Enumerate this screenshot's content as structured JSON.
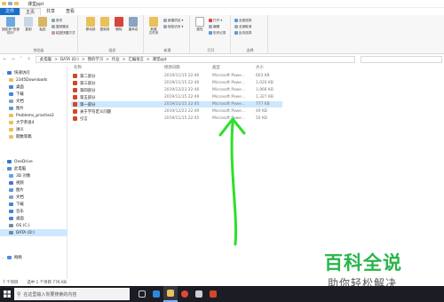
{
  "window": {
    "title": "课堂ppt"
  },
  "ribbon": {
    "tabs": [
      "文件",
      "主页",
      "共享",
      "查看"
    ],
    "active_tab": "主页",
    "groups": {
      "clipboard": {
        "title": "剪贴板",
        "pin": "固定到\"快速访问\"",
        "copy": "复制",
        "paste": "粘贴",
        "cut": "剪切",
        "copy_path": "复制路径",
        "paste_shortcut": "粘贴快捷方式"
      },
      "organize": {
        "title": "组织",
        "move_to": "移动到",
        "copy_to": "复制到",
        "delete": "删除",
        "rename": "重命名"
      },
      "new": {
        "title": "新建",
        "new_folder": "新建\n文件夹",
        "new_item": "新建项目 ▾",
        "easy_access": "轻松访问 ▾"
      },
      "open": {
        "title": "打开",
        "properties": "属性",
        "open": "打开 ▾",
        "edit": "编辑",
        "history": "历史记录"
      },
      "select": {
        "title": "选择",
        "select_all": "全部选择",
        "select_none": "全部取消",
        "invert": "反向选择"
      }
    }
  },
  "address": {
    "crumbs": [
      "此电脑",
      "DATA (D:)",
      "我的学习",
      "作业",
      "汇编语言",
      "课堂ppt"
    ],
    "separator": ">"
  },
  "nav": {
    "items": [
      {
        "label": "快速访问",
        "icon": "star-icon",
        "color": "#3a7bd5",
        "indent": 0
      },
      {
        "label": "2345Downloads",
        "icon": "folder-icon",
        "color": "#e8c15a",
        "indent": 1
      },
      {
        "label": "桌面",
        "icon": "desktop-icon",
        "color": "#3f86d6",
        "indent": 1
      },
      {
        "label": "下载",
        "icon": "download-icon",
        "color": "#3f86d6",
        "indent": 1
      },
      {
        "label": "文档",
        "icon": "document-icon",
        "color": "#8aa3c2",
        "indent": 1
      },
      {
        "label": "图片",
        "icon": "picture-icon",
        "color": "#5a9bd8",
        "indent": 1
      },
      {
        "label": "Problems_practise2",
        "icon": "folder-icon",
        "color": "#e8c15a",
        "indent": 1
      },
      {
        "label": "大学英语4",
        "icon": "folder-icon",
        "color": "#e8c15a",
        "indent": 1
      },
      {
        "label": "讲义",
        "icon": "folder-icon",
        "color": "#e8c15a",
        "indent": 1
      },
      {
        "label": "期数等稿",
        "icon": "folder-icon",
        "color": "#e8c15a",
        "indent": 1
      },
      {
        "label": "OneDrive",
        "icon": "cloud-icon",
        "color": "#2f7bd4",
        "indent": 0
      },
      {
        "label": "此电脑",
        "icon": "computer-icon",
        "color": "#4b8fd8",
        "indent": 0
      },
      {
        "label": "3D 对象",
        "icon": "cube-icon",
        "color": "#5aa6e6",
        "indent": 1
      },
      {
        "label": "视频",
        "icon": "video-icon",
        "color": "#5a6bd8",
        "indent": 1
      },
      {
        "label": "图片",
        "icon": "picture-icon",
        "color": "#5a9bd8",
        "indent": 1
      },
      {
        "label": "文档",
        "icon": "document-icon",
        "color": "#8aa3c2",
        "indent": 1
      },
      {
        "label": "下载",
        "icon": "download-icon",
        "color": "#3f86d6",
        "indent": 1
      },
      {
        "label": "音乐",
        "icon": "music-icon",
        "color": "#3f86d6",
        "indent": 1
      },
      {
        "label": "桌面",
        "icon": "desktop-icon",
        "color": "#3f86d6",
        "indent": 1
      },
      {
        "label": "OS (C:)",
        "icon": "drive-icon",
        "color": "#7a8a9a",
        "indent": 1
      },
      {
        "label": "DATA (D:)",
        "icon": "drive-icon",
        "color": "#7a8a9a",
        "indent": 1,
        "selected": true
      },
      {
        "label": "网络",
        "icon": "network-icon",
        "color": "#4b8fd8",
        "indent": 0
      }
    ]
  },
  "files": {
    "columns": {
      "name": "名称",
      "date": "修改日期",
      "type": "类型",
      "size": "大小"
    },
    "rows": [
      {
        "name": "第二部分",
        "date": "2019/11/15 22:46",
        "type": "Microsoft Powe...",
        "size": "603 KB"
      },
      {
        "name": "第三部分",
        "date": "2019/11/15 22:46",
        "type": "Microsoft Powe...",
        "size": "1,020 KB"
      },
      {
        "name": "第四部分",
        "date": "2019/12/23 22:46",
        "type": "Microsoft Powe...",
        "size": "1,966 KB"
      },
      {
        "name": "第五部分",
        "date": "2019/11/15 22:49",
        "type": "Microsoft Powe...",
        "size": "1,327 KB"
      },
      {
        "name": "第一部分",
        "date": "2019/11/15 22:45",
        "type": "Microsoft Powe...",
        "size": "777 KB",
        "selected": true
      },
      {
        "name": "关于字符定义问题",
        "date": "2019/12/23 22:49",
        "type": "Microsoft Powe...",
        "size": "49 KB"
      },
      {
        "name": "引言",
        "date": "2019/11/15 22:45",
        "type": "Microsoft Powe...",
        "size": "50 KB"
      }
    ]
  },
  "status": {
    "count": "7 个项目",
    "selected": "选中 1 个项目  776 KB"
  },
  "taskbar": {
    "search_placeholder": "在这里输入你要搜索的内容"
  },
  "watermark": {
    "title": "百科全说",
    "subtitle": "助你轻松解决"
  },
  "colors": {
    "accent": "#1a6fc9",
    "selection": "#cce8ff",
    "annotation": "#2de02a",
    "watermark": "#27b54a"
  }
}
